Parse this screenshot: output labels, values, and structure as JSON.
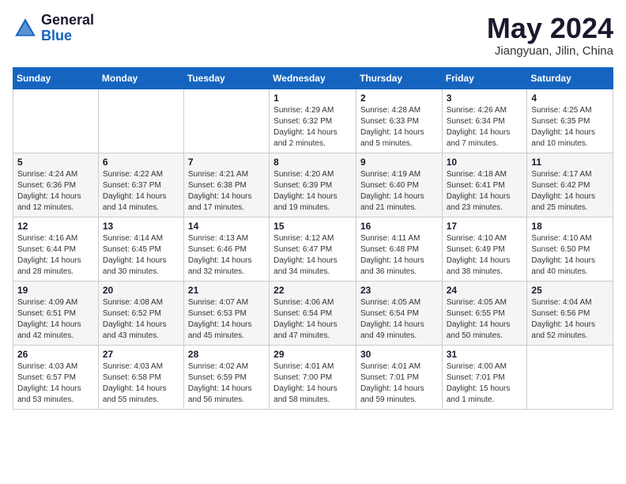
{
  "logo": {
    "general": "General",
    "blue": "Blue"
  },
  "title": {
    "month_year": "May 2024",
    "location": "Jiangyuan, Jilin, China"
  },
  "days_of_week": [
    "Sunday",
    "Monday",
    "Tuesday",
    "Wednesday",
    "Thursday",
    "Friday",
    "Saturday"
  ],
  "weeks": [
    [
      {
        "day": "",
        "info": ""
      },
      {
        "day": "",
        "info": ""
      },
      {
        "day": "",
        "info": ""
      },
      {
        "day": "1",
        "info": "Sunrise: 4:29 AM\nSunset: 6:32 PM\nDaylight: 14 hours\nand 2 minutes."
      },
      {
        "day": "2",
        "info": "Sunrise: 4:28 AM\nSunset: 6:33 PM\nDaylight: 14 hours\nand 5 minutes."
      },
      {
        "day": "3",
        "info": "Sunrise: 4:26 AM\nSunset: 6:34 PM\nDaylight: 14 hours\nand 7 minutes."
      },
      {
        "day": "4",
        "info": "Sunrise: 4:25 AM\nSunset: 6:35 PM\nDaylight: 14 hours\nand 10 minutes."
      }
    ],
    [
      {
        "day": "5",
        "info": "Sunrise: 4:24 AM\nSunset: 6:36 PM\nDaylight: 14 hours\nand 12 minutes."
      },
      {
        "day": "6",
        "info": "Sunrise: 4:22 AM\nSunset: 6:37 PM\nDaylight: 14 hours\nand 14 minutes."
      },
      {
        "day": "7",
        "info": "Sunrise: 4:21 AM\nSunset: 6:38 PM\nDaylight: 14 hours\nand 17 minutes."
      },
      {
        "day": "8",
        "info": "Sunrise: 4:20 AM\nSunset: 6:39 PM\nDaylight: 14 hours\nand 19 minutes."
      },
      {
        "day": "9",
        "info": "Sunrise: 4:19 AM\nSunset: 6:40 PM\nDaylight: 14 hours\nand 21 minutes."
      },
      {
        "day": "10",
        "info": "Sunrise: 4:18 AM\nSunset: 6:41 PM\nDaylight: 14 hours\nand 23 minutes."
      },
      {
        "day": "11",
        "info": "Sunrise: 4:17 AM\nSunset: 6:42 PM\nDaylight: 14 hours\nand 25 minutes."
      }
    ],
    [
      {
        "day": "12",
        "info": "Sunrise: 4:16 AM\nSunset: 6:44 PM\nDaylight: 14 hours\nand 28 minutes."
      },
      {
        "day": "13",
        "info": "Sunrise: 4:14 AM\nSunset: 6:45 PM\nDaylight: 14 hours\nand 30 minutes."
      },
      {
        "day": "14",
        "info": "Sunrise: 4:13 AM\nSunset: 6:46 PM\nDaylight: 14 hours\nand 32 minutes."
      },
      {
        "day": "15",
        "info": "Sunrise: 4:12 AM\nSunset: 6:47 PM\nDaylight: 14 hours\nand 34 minutes."
      },
      {
        "day": "16",
        "info": "Sunrise: 4:11 AM\nSunset: 6:48 PM\nDaylight: 14 hours\nand 36 minutes."
      },
      {
        "day": "17",
        "info": "Sunrise: 4:10 AM\nSunset: 6:49 PM\nDaylight: 14 hours\nand 38 minutes."
      },
      {
        "day": "18",
        "info": "Sunrise: 4:10 AM\nSunset: 6:50 PM\nDaylight: 14 hours\nand 40 minutes."
      }
    ],
    [
      {
        "day": "19",
        "info": "Sunrise: 4:09 AM\nSunset: 6:51 PM\nDaylight: 14 hours\nand 42 minutes."
      },
      {
        "day": "20",
        "info": "Sunrise: 4:08 AM\nSunset: 6:52 PM\nDaylight: 14 hours\nand 43 minutes."
      },
      {
        "day": "21",
        "info": "Sunrise: 4:07 AM\nSunset: 6:53 PM\nDaylight: 14 hours\nand 45 minutes."
      },
      {
        "day": "22",
        "info": "Sunrise: 4:06 AM\nSunset: 6:54 PM\nDaylight: 14 hours\nand 47 minutes."
      },
      {
        "day": "23",
        "info": "Sunrise: 4:05 AM\nSunset: 6:54 PM\nDaylight: 14 hours\nand 49 minutes."
      },
      {
        "day": "24",
        "info": "Sunrise: 4:05 AM\nSunset: 6:55 PM\nDaylight: 14 hours\nand 50 minutes."
      },
      {
        "day": "25",
        "info": "Sunrise: 4:04 AM\nSunset: 6:56 PM\nDaylight: 14 hours\nand 52 minutes."
      }
    ],
    [
      {
        "day": "26",
        "info": "Sunrise: 4:03 AM\nSunset: 6:57 PM\nDaylight: 14 hours\nand 53 minutes."
      },
      {
        "day": "27",
        "info": "Sunrise: 4:03 AM\nSunset: 6:58 PM\nDaylight: 14 hours\nand 55 minutes."
      },
      {
        "day": "28",
        "info": "Sunrise: 4:02 AM\nSunset: 6:59 PM\nDaylight: 14 hours\nand 56 minutes."
      },
      {
        "day": "29",
        "info": "Sunrise: 4:01 AM\nSunset: 7:00 PM\nDaylight: 14 hours\nand 58 minutes."
      },
      {
        "day": "30",
        "info": "Sunrise: 4:01 AM\nSunset: 7:01 PM\nDaylight: 14 hours\nand 59 minutes."
      },
      {
        "day": "31",
        "info": "Sunrise: 4:00 AM\nSunset: 7:01 PM\nDaylight: 15 hours\nand 1 minute."
      },
      {
        "day": "",
        "info": ""
      }
    ]
  ]
}
